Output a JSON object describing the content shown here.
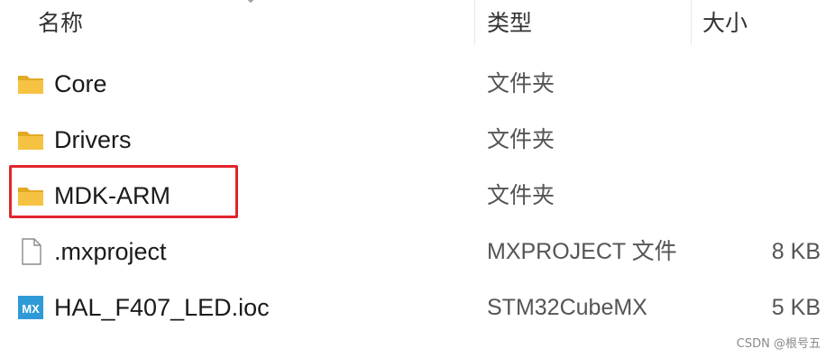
{
  "header": {
    "name_label": "名称",
    "type_label": "类型",
    "size_label": "大小"
  },
  "files": [
    {
      "name": "Core",
      "type": "文件夹",
      "size": "",
      "icon": "folder-icon"
    },
    {
      "name": "Drivers",
      "type": "文件夹",
      "size": "",
      "icon": "folder-icon"
    },
    {
      "name": "MDK-ARM",
      "type": "文件夹",
      "size": "",
      "icon": "folder-icon",
      "highlighted": true
    },
    {
      "name": ".mxproject",
      "type": "MXPROJECT 文件",
      "size": "8 KB",
      "icon": "file-icon"
    },
    {
      "name": "HAL_F407_LED.ioc",
      "type": "STM32CubeMX",
      "size": "5 KB",
      "icon": "stm32cubemx-icon",
      "icon_text": "MX"
    }
  ],
  "colors": {
    "folder": "#f5c242",
    "folder_dark": "#e3a923",
    "highlight": "#e0242b",
    "mx_icon": "#2f9ad8"
  },
  "watermark": "CSDN @根号五"
}
